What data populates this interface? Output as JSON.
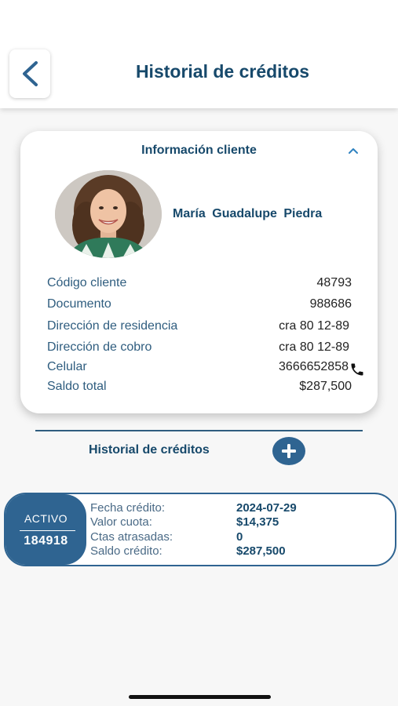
{
  "header": {
    "title": "Historial de créditos"
  },
  "client_card": {
    "title": "Información cliente",
    "name": "María Guadalupe Piedra",
    "rows": [
      {
        "label": "Código cliente",
        "value": "48793"
      },
      {
        "label": "Documento",
        "value": "988686"
      },
      {
        "label": "Dirección de residencia",
        "value": "cra 80 12-89"
      },
      {
        "label": "Dirección de cobro",
        "value": "cra 80 12-89"
      },
      {
        "label": "Celular",
        "value": "3666652858"
      },
      {
        "label": "Saldo total",
        "value": "$287,500"
      }
    ]
  },
  "history": {
    "title": "Historial de créditos"
  },
  "credit": {
    "status": "ACTIVO",
    "number": "184918",
    "rows": [
      {
        "label": "Fecha crédito:",
        "value": "2024-07-29"
      },
      {
        "label": "Valor cuota:",
        "value": "$14,375"
      },
      {
        "label": "Ctas atrasadas:",
        "value": "0"
      },
      {
        "label": "Saldo crédito:",
        "value": "$287,500"
      }
    ]
  },
  "colors": {
    "primary": "#17496b",
    "accent": "#2f6491",
    "background": "#f7f7f7"
  },
  "icons": {
    "back": "chevron-left-icon",
    "collapse": "chevron-up-icon",
    "phone": "phone-icon",
    "add": "plus-icon"
  }
}
